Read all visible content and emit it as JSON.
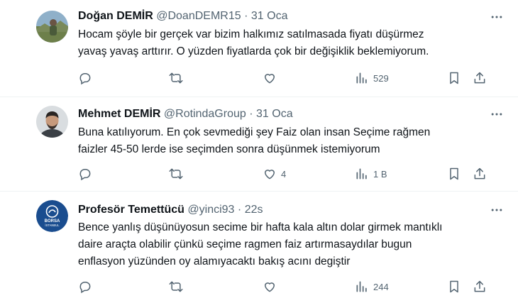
{
  "tweets": [
    {
      "name": "Doğan DEMİR",
      "handle": "@DoanDEMR15",
      "separator": "·",
      "time": "31 Oca",
      "lines": [
        "Hocam şöyle bir gerçek var bizim halkımız satılmasada  fiyatı düşürmez",
        "yavaş yavaş arttırır. O yüzden fiyatlarda çok bir değişiklik beklemiyorum."
      ],
      "likes": "",
      "views": "529",
      "avatar": "landscape-photo"
    },
    {
      "name": "Mehmet DEMİR",
      "handle": "@RotindaGroup",
      "separator": "·",
      "time": "31 Oca",
      "lines": [
        "Buna katılıyorum. En çok sevmediği şey Faiz olan insan Seçime rağmen",
        "faizler 45-50 lerde ise seçimden sonra düşünmek istemiyorum"
      ],
      "likes": "4",
      "views": "1 B",
      "avatar": "person-photo"
    },
    {
      "name": "Profesör Temettücü",
      "handle": "@yinci93",
      "separator": "·",
      "time": "22s",
      "lines": [
        "Bence yanlış düşünüyosun secime bir hafta kala altın dolar girmek mantıklı",
        "daire araçta olabilir çünkü seçime ragmen faiz artırmasaydılar bugun",
        "enflasyon yüzünden oy alamıyacaktı bakış acını degiştir"
      ],
      "likes": "",
      "views": "244",
      "avatar": "borsa-istanbul-logo",
      "avatar_text": [
        "BORSA",
        "İSTANBUL"
      ]
    }
  ],
  "colors": {
    "text": "#0f1419",
    "secondary": "#536471",
    "divider": "#eff3f4",
    "logo_blue": "#1a4d8f"
  }
}
